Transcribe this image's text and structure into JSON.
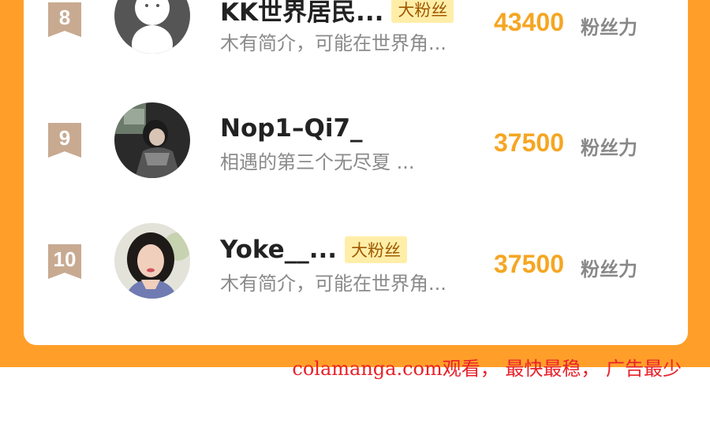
{
  "leaderboard": {
    "entries": [
      {
        "rank": "8",
        "name": "KK世界居民...",
        "badge": "大粉丝",
        "description": "木有简介，可能在世界角...",
        "score": "43400",
        "unit": "粉丝力",
        "avatar": "default-avatar-icon"
      },
      {
        "rank": "9",
        "name": "Nop1–Qi7_",
        "badge": "",
        "description": "相遇的第三个无尽夏 ...",
        "score": "37500",
        "unit": "粉丝力",
        "avatar": "user-photo"
      },
      {
        "rank": "10",
        "name": "Yoke__...",
        "badge": "大粉丝",
        "description": "木有简介，可能在世界角...",
        "score": "37500",
        "unit": "粉丝力",
        "avatar": "user-photo"
      }
    ]
  },
  "watermark": "colamanga.com观看， 最快最稳， 广告最少",
  "colors": {
    "frame": "#FF9F29",
    "rank_badge": "#C8AA91",
    "score": "#F5A623",
    "fan_badge_bg": "#FFEEA8",
    "watermark": "#E8222B"
  }
}
